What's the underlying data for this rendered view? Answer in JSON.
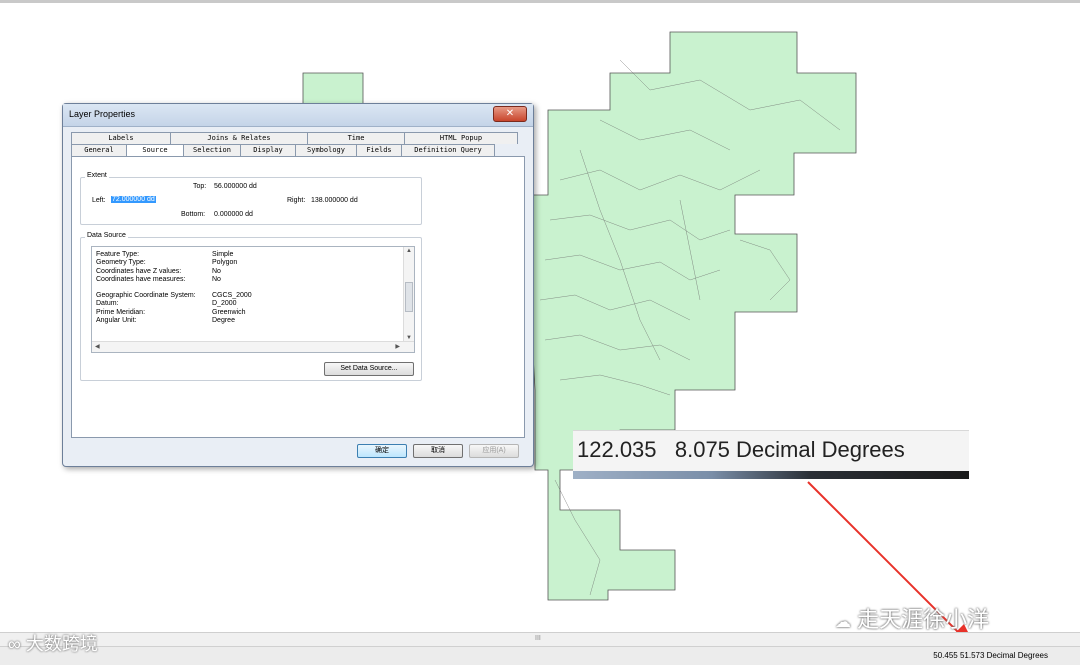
{
  "dialog": {
    "title": "Layer Properties",
    "close_glyph": "✕",
    "tabs_top": [
      "Labels",
      "Joins & Relates",
      "Time",
      "HTML Popup"
    ],
    "tabs_bottom": [
      "General",
      "Source",
      "Selection",
      "Display",
      "Symbology",
      "Fields",
      "Definition Query"
    ],
    "active_tab": "Source",
    "extent": {
      "group_label": "Extent",
      "top_label": "Top:",
      "top_value": "56.000000 dd",
      "left_label": "Left:",
      "left_value": "72.000000 dd",
      "right_label": "Right:",
      "right_value": "138.000000 dd",
      "bottom_label": "Bottom:",
      "bottom_value": "0.000000 dd"
    },
    "data_source": {
      "group_label": "Data Source",
      "rows": [
        {
          "key": "Feature Type:",
          "value": "Simple"
        },
        {
          "key": "Geometry Type:",
          "value": "Polygon"
        },
        {
          "key": "Coordinates have Z values:",
          "value": "No"
        },
        {
          "key": "Coordinates have measures:",
          "value": "No"
        },
        {
          "key": "",
          "value": ""
        },
        {
          "key": "Geographic Coordinate System:",
          "value": "CGCS_2000"
        },
        {
          "key": "Datum:",
          "value": "D_2000"
        },
        {
          "key": "Prime Meridian:",
          "value": "Greenwich"
        },
        {
          "key": "Angular Unit:",
          "value": "Degree"
        }
      ],
      "set_button": "Set Data Source..."
    },
    "buttons": {
      "ok": "确定",
      "cancel": "取消",
      "apply": "应用(A)"
    }
  },
  "zoom_coords": "122.035   8.075 Decimal Degrees",
  "status_coords": "50.455  51.573 Decimal Degrees",
  "scroll_grip": "III",
  "watermark_left": "大数跨境",
  "watermark_right": "走天涯徐小洋",
  "colors": {
    "map_fill": "#c9f2cf",
    "map_stroke": "#555555",
    "arrow": "#e8322a"
  }
}
